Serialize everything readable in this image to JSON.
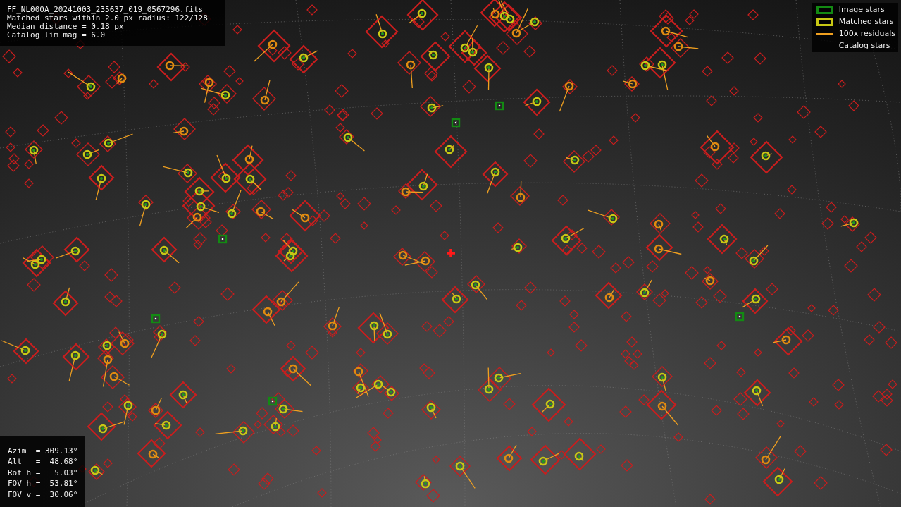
{
  "info_box": {
    "lines": [
      "FF_NL000A_20241003_235637_019_0567296.fits",
      "Matched stars within 2.0 px radius: 122/128",
      "Median distance = 0.18 px",
      "Catalog lim mag = 6.0"
    ]
  },
  "legend": {
    "items": [
      {
        "label": "Image stars",
        "kind": "box",
        "color": "#138a13"
      },
      {
        "label": "Matched stars",
        "kind": "box",
        "color": "#c8c814"
      },
      {
        "label": "100x residuals",
        "kind": "line",
        "color": "#f0a020"
      },
      {
        "label": "Catalog stars",
        "kind": "none"
      }
    ]
  },
  "pointing_box": {
    "lines": [
      "Azim  = 309.13°",
      "Alt   =  48.68°",
      "Rot h =   5.03°",
      "FOV h =  53.81°",
      "FOV v =  30.06°"
    ]
  }
}
